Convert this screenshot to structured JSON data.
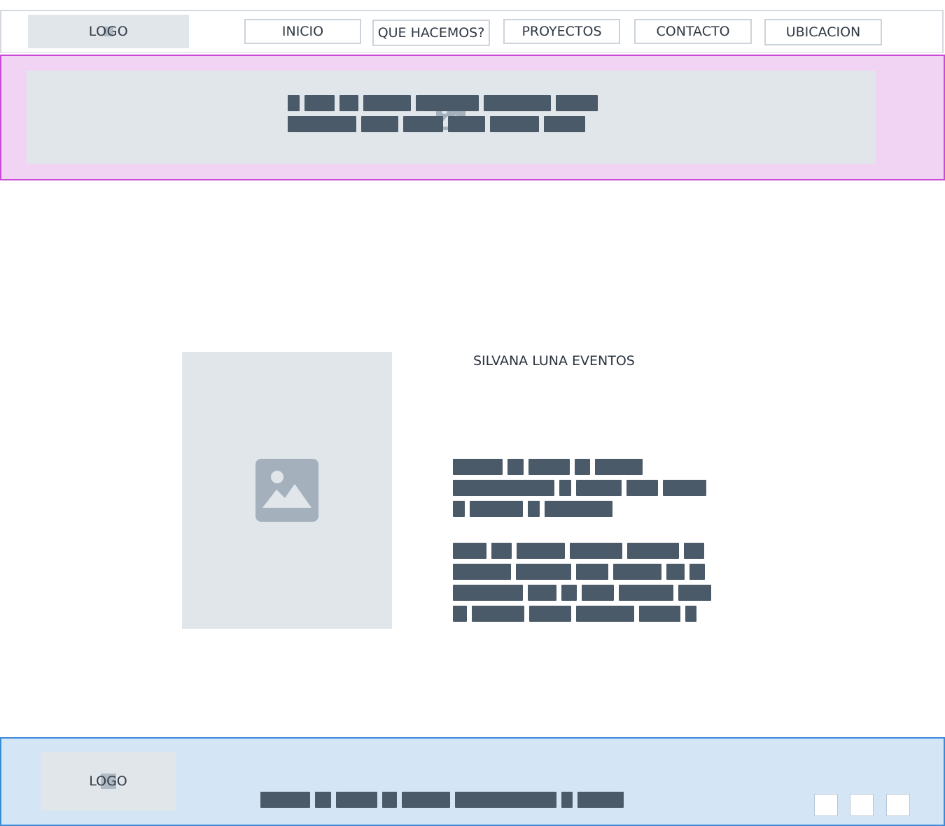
{
  "header": {
    "logo_text": "LOGO",
    "nav": [
      {
        "label": "INICIO"
      },
      {
        "label": "QUE HACEMOS?"
      },
      {
        "label": "PROYECTOS"
      },
      {
        "label": "CONTACTO"
      },
      {
        "label": "UBICACION"
      }
    ]
  },
  "hero": {
    "icon": "image-placeholder-icon"
  },
  "main": {
    "photo_icon": "image-placeholder-icon",
    "title": "SILVANA LUNA EVENTOS"
  },
  "footer": {
    "logo_text": "LOGO",
    "social_icons": [
      "social-icon",
      "social-icon",
      "social-icon"
    ]
  },
  "colors": {
    "hero_bg": "#f1d3f3",
    "hero_border": "#c94bd5",
    "footer_bg": "#d4e5f5",
    "footer_border": "#3a8ad8",
    "placeholder_gray": "#e1e6ea",
    "text_bar": "#4b5a68"
  }
}
